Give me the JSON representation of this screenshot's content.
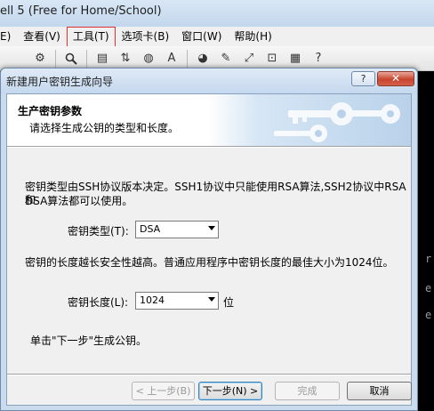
{
  "app": {
    "title": "ell 5 (Free for Home/School)",
    "menu": [
      "E)",
      "查看(V)",
      "工具(T)",
      "选项卡(B)",
      "窗口(W)",
      "帮助(H)"
    ],
    "terminal_glyphs": [
      "r",
      "e",
      "e"
    ]
  },
  "dialog": {
    "title": "新建用户密钥生成向导",
    "help_label": "?",
    "close_label": "✕",
    "header": {
      "title": "生产密钥参数",
      "subtitle": "请选择生成公钥的类型和长度。"
    },
    "body": {
      "desc1_line1": "密钥类型由SSH协议版本决定。SSH1协议中只能使用RSA算法,SSH2协议中RSA和",
      "desc1_line2": "DSA算法都可以使用。",
      "key_type_label": "密钥类型(T):",
      "key_type_value": "DSA",
      "desc2": "密钥的长度越长安全性越高。普通应用程序中密钥长度的最佳大小为1024位。",
      "key_length_label": "密钥长度(L):",
      "key_length_value": "1024",
      "key_length_unit": "位",
      "hint": "单击\"下一步\"生成公钥。"
    },
    "buttons": {
      "back": "< 上一步(B)",
      "next": "下一步(N) >",
      "finish": "完成",
      "cancel": "取消"
    }
  }
}
